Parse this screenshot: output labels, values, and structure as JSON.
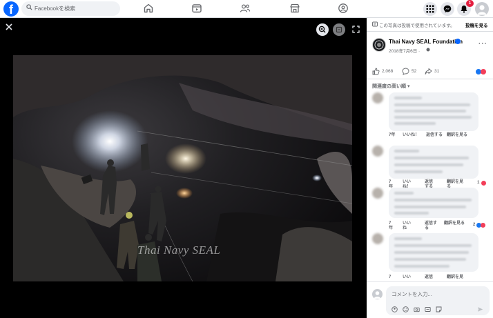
{
  "topbar": {
    "logo": "f",
    "search_placeholder": "Facebookを検索",
    "notification_count": "1",
    "nav_icons": [
      "home-icon",
      "video-icon",
      "friends-icon",
      "marketplace-icon",
      "groups-icon"
    ]
  },
  "viewer": {
    "watermark": "Thai Navy SEAL"
  },
  "pane": {
    "notice": "この写真は投稿で使用されています。",
    "notice_link": "投稿を見る",
    "page_name": "Thai Navy SEAL Foundation",
    "post_date": "2018年7月6日 ·",
    "reactions_count": "2,068",
    "comments_count": "52",
    "shares_count": "31",
    "sort_label": "関連度の高い順"
  },
  "comments": [
    {
      "age": "7年",
      "like": "いいね！",
      "reply": "返信する",
      "translate": "翻訳を見る",
      "reactions": ""
    },
    {
      "age": "7\n年",
      "like": "いい\nね！",
      "reply": "返信\nする",
      "translate": "翻訳を見\nる",
      "reactions": "1"
    },
    {
      "age": "7\n年",
      "like": "いい\nね",
      "reply": "返信す\nる",
      "translate": "翻訳を見る",
      "reactions": "2"
    },
    {
      "age": "7",
      "like": "いい",
      "reply": "返信",
      "translate": "翻訳を見",
      "reactions": ""
    }
  ],
  "composer": {
    "placeholder": "コメントを入力..."
  },
  "colors": {
    "brand": "#0866ff",
    "badge": "#e41e3f",
    "like": "#1877f2",
    "love": "#f33e58"
  }
}
